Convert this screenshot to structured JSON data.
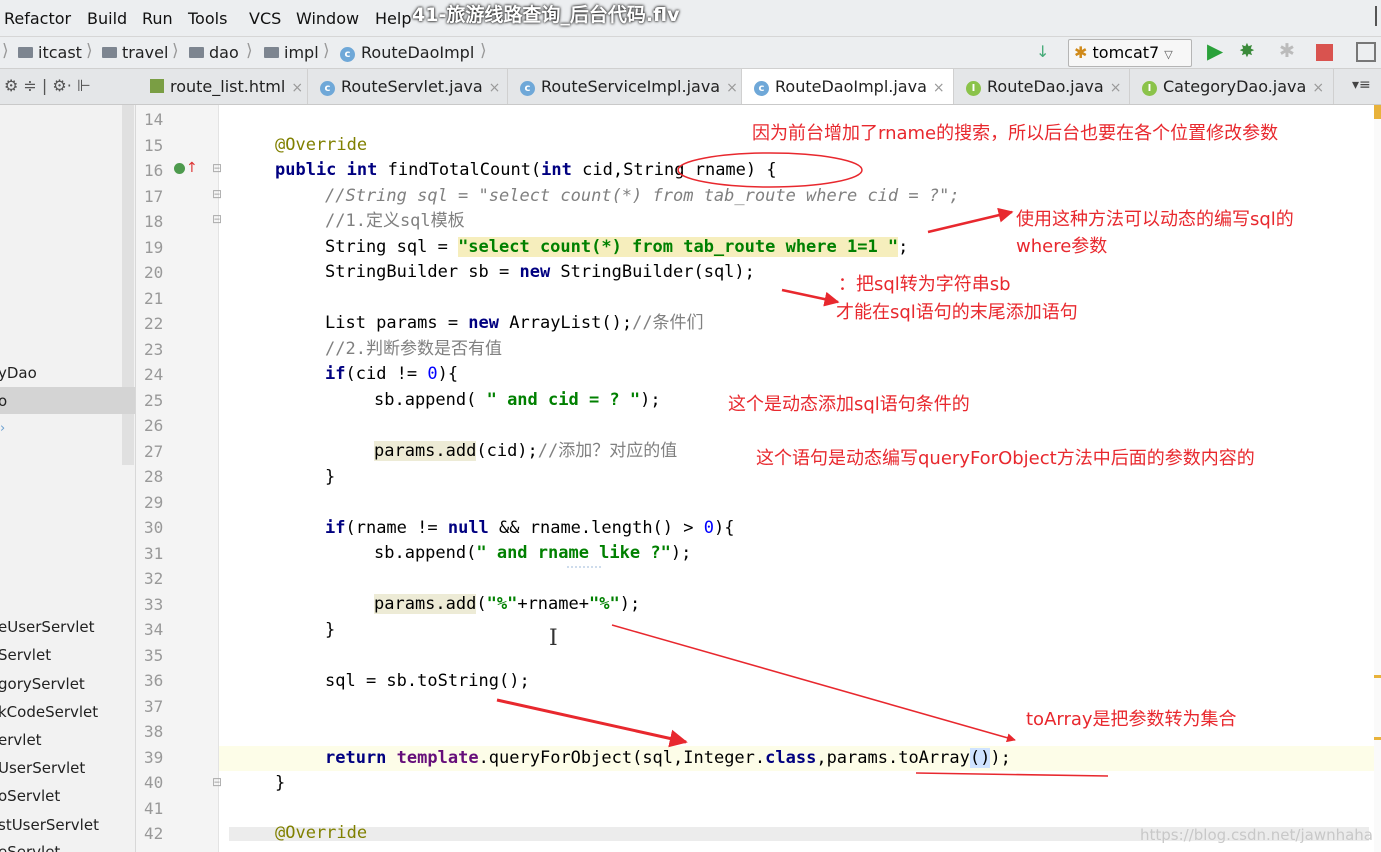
{
  "video_title": "41-旅游线路查询_后台代码.flv",
  "menu": [
    "Refactor",
    "Build",
    "Run",
    "Tools",
    "VCS",
    "Window",
    "Help"
  ],
  "breadcrumb": [
    "itcast",
    "travel",
    "dao",
    "impl",
    "RouteDaoImpl"
  ],
  "run_config": "tomcat7",
  "tabs": [
    "route_list.html",
    "RouteServlet.java",
    "RouteServiceImpl.java",
    "RouteDaoImpl.java",
    "RouteDao.java",
    "CategoryDao.java"
  ],
  "sidebar": {
    "items": [
      "yDao",
      "o",
      "eUserServlet",
      "Servlet",
      "goryServlet",
      "kCodeServlet",
      "ervlet",
      "UserServlet",
      "oServlet",
      "stUserServlet",
      "eServlet"
    ]
  },
  "line_numbers": [
    "14",
    "15",
    "16",
    "17",
    "18",
    "19",
    "20",
    "21",
    "22",
    "23",
    "24",
    "25",
    "26",
    "27",
    "28",
    "29",
    "30",
    "31",
    "32",
    "33",
    "34",
    "35",
    "36",
    "37",
    "38",
    "39",
    "40",
    "41",
    "42"
  ],
  "code": {
    "l15_annotation": "@Override",
    "l16_pub": "public",
    "l16_int": "int",
    "l16_name": "findTotalCount(",
    "l16_int2": "int",
    "l16_rest": "cid,String rname) {",
    "l17": "//String sql = \"select count(*) from tab_route where cid = ?\";",
    "l18": "//1.定义sql模板",
    "l19_a": "String sql = ",
    "l19_str": "\"select count(*) from tab_route where 1=1 \"",
    "l19_end": ";",
    "l20_a": "StringBuilder sb = ",
    "l20_new": "new",
    "l20_b": " StringBuilder(sql);",
    "l22_a": "List params = ",
    "l22_new": "new",
    "l22_b": " ArrayList();",
    "l22_cm": "//条件们",
    "l23": "//2.判断参数是否有值",
    "l24_if": "if",
    "l24_a": "(cid != ",
    "l24_num": "0",
    "l24_b": "){",
    "l25_a": "sb.append( ",
    "l25_str": "\" and cid = ? \"",
    "l25_b": ");",
    "l27_hl": "params.add",
    "l27_a": "(cid);",
    "l27_cm": "//添加？对应的值",
    "l28": "}",
    "l30_if": "if",
    "l30_a": "(rname != ",
    "l30_null": "null",
    "l30_b": " && rname.length() > ",
    "l30_num": "0",
    "l30_c": "){",
    "l31_a": "sb.append(",
    "l31_str": "\" and rname like ?\"",
    "l31_b": ");",
    "l33_hl": "params.add",
    "l33_a": "(",
    "l33_s1": "\"%\"",
    "l33_b": "+rname+",
    "l33_s2": "\"%\"",
    "l33_c": ");",
    "l34": "}",
    "l36": "sql = sb.toString();",
    "l39_ret": "return",
    "l39_tpl": "template",
    "l39_a": ".queryForObject(sql,Integer.",
    "l39_cls": "class",
    "l39_b": ",params.toArray",
    "l39_c": "()",
    "l39_d": ");",
    "l40": "}",
    "l42": "@Override"
  },
  "annotations": {
    "a1": "因为前台增加了rname的搜索，所以后台也要在各个位置修改参数",
    "a2": "使用这种方法可以动态的编写sql的",
    "a3": "where参数",
    "a4": "：把sql转为字符串sb",
    "a5": "才能在sql语句的末尾添加语句",
    "a6": "这个是动态添加sql语句条件的",
    "a7": "这个语句是动态编写queryForObject方法中后面的参数内容的",
    "a8": "toArray是把参数转为集合"
  },
  "watermark": "https://blog.csdn.net/jawnhaha",
  "colors": {
    "annotation_red": "#e8282e",
    "keyword": "#000080",
    "string": "#008000"
  }
}
